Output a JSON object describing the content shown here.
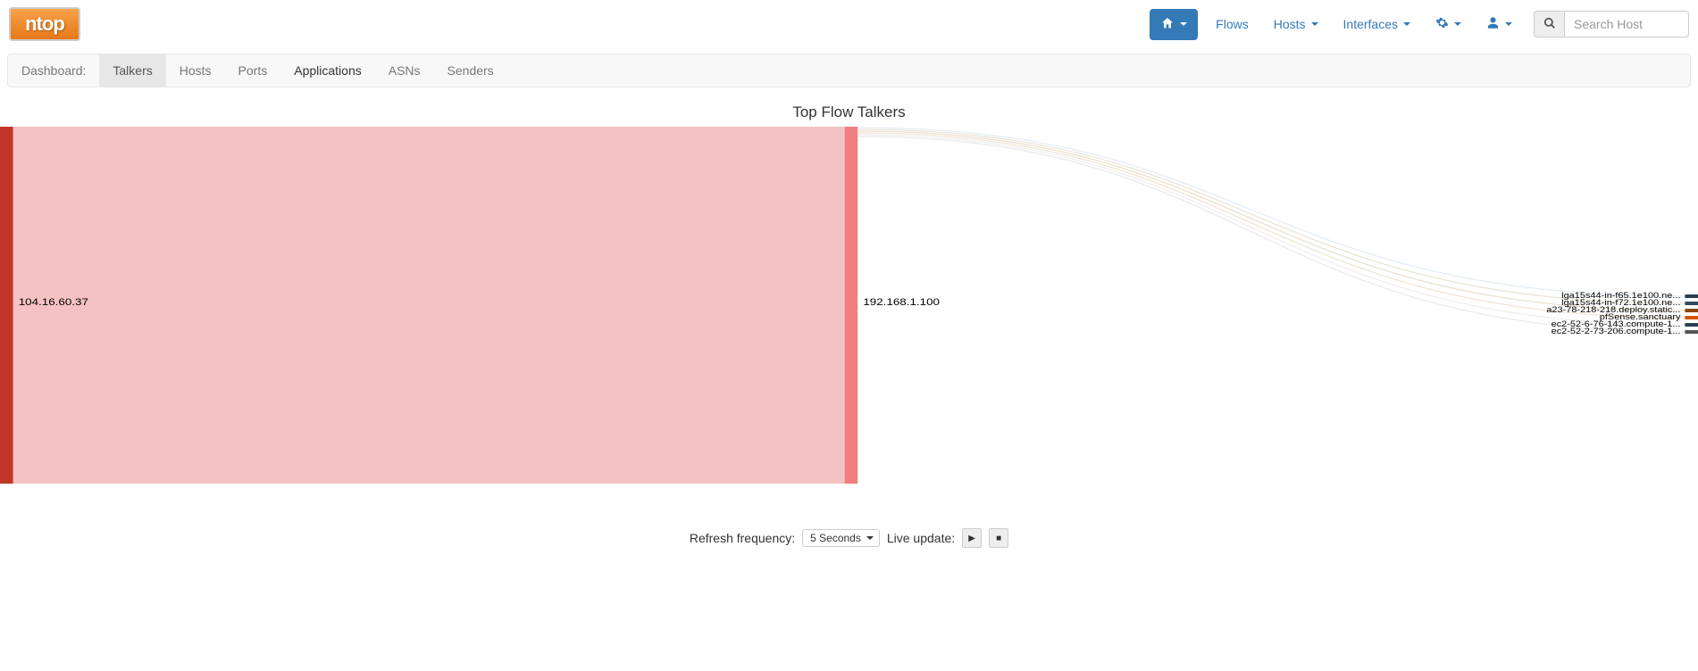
{
  "brand": "ntop",
  "search": {
    "placeholder": "Search Host"
  },
  "nav": {
    "home_label": "",
    "flows": "Flows",
    "hosts": "Hosts",
    "interfaces": "Interfaces"
  },
  "subnav": {
    "label": "Dashboard:",
    "items": [
      {
        "label": "Talkers",
        "active": true
      },
      {
        "label": "Hosts"
      },
      {
        "label": "Ports"
      },
      {
        "label": "Applications",
        "dark": true
      },
      {
        "label": "ASNs"
      },
      {
        "label": "Senders"
      }
    ]
  },
  "chart": {
    "title": "Top Flow Talkers"
  },
  "chart_data": {
    "type": "sankey",
    "left_node": {
      "label": "104.16.60.37",
      "value": 100,
      "color": "#c0392b"
    },
    "middle_node": {
      "label": "192.168.1.100",
      "value": 100,
      "color": "#f08080"
    },
    "right_nodes": [
      {
        "label": "lga15s44-in-f65.1e100.ne...",
        "value": 1,
        "color": "#2c3e50"
      },
      {
        "label": "lga15s44-in-f72.1e100.ne...",
        "value": 1,
        "color": "#34495e"
      },
      {
        "label": "a23-78-218-218.deploy.static...",
        "value": 1,
        "color": "#8b4513"
      },
      {
        "label": "pfSense.sanctuary",
        "value": 1,
        "color": "#d35400"
      },
      {
        "label": "ec2-52-6-76-143.compute-1...",
        "value": 1,
        "color": "#2c3e50"
      },
      {
        "label": "ec2-52-2-73-206.compute-1...",
        "value": 1,
        "color": "#555"
      }
    ],
    "link_left_middle": {
      "color": "#f4c2c2",
      "opacity": 1,
      "value": 100
    },
    "links_middle_right": [
      {
        "color": "#dfeaf4",
        "value": 1
      },
      {
        "color": "#e8e0d0",
        "value": 1
      },
      {
        "color": "#e8dcc8",
        "value": 1
      },
      {
        "color": "#f0e0cc",
        "value": 1
      },
      {
        "color": "#ececec",
        "value": 1
      },
      {
        "color": "#e8e8e8",
        "value": 1
      }
    ]
  },
  "footer": {
    "refresh_label": "Refresh frequency:",
    "refresh_value": "5 Seconds",
    "live_label": "Live update:"
  }
}
